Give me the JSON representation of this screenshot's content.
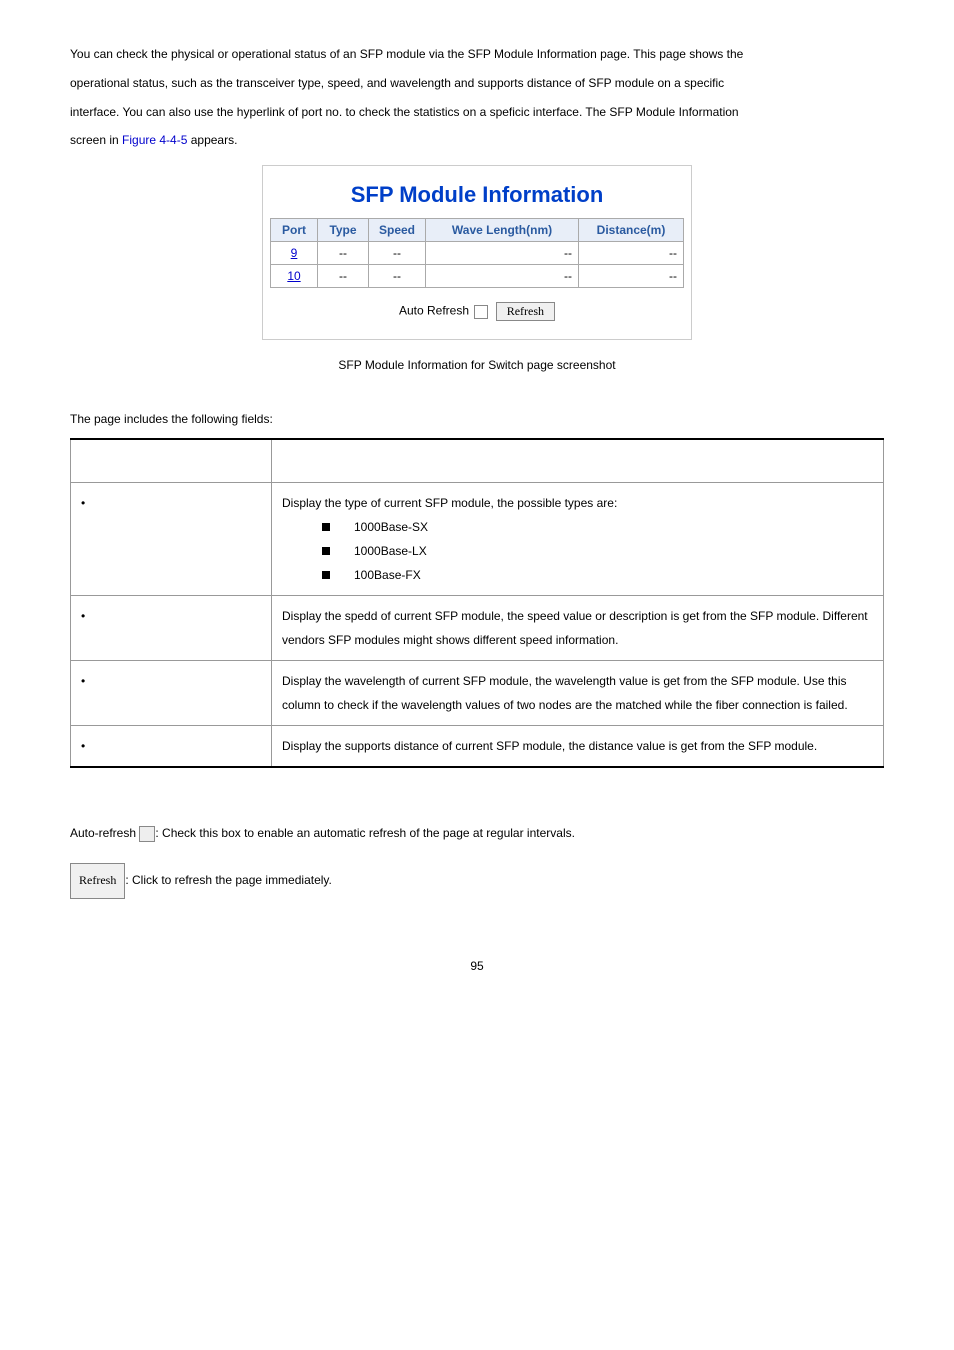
{
  "intro": {
    "line1": "You can check the physical or operational status of an SFP module via the SFP Module Information page. This page shows the",
    "line2": "operational status, such as the transceiver type, speed, and wavelength and supports distance of SFP module on a specific",
    "line3": "interface. You can also use the hyperlink of port no. to check the statistics on a speficic interface. The SFP Module Information",
    "line4a": "screen in ",
    "figref": "Figure 4-4-5",
    "line4b": " appears."
  },
  "panel": {
    "title": "SFP Module Information",
    "headers": [
      "Port",
      "Type",
      "Speed",
      "Wave Length(nm)",
      "Distance(m)"
    ],
    "rows": [
      {
        "port": "9",
        "type": "--",
        "speed": "--",
        "wave": "--",
        "dist": "--"
      },
      {
        "port": "10",
        "type": "--",
        "speed": "--",
        "wave": "--",
        "dist": "--"
      }
    ],
    "auto_refresh_label": "Auto Refresh",
    "refresh_label": "Refresh"
  },
  "caption": "SFP Module Information for Switch page screenshot",
  "fields_intro": "The page includes the following fields:",
  "fields": {
    "type": {
      "desc": "Display the type of current SFP module, the possible types are:",
      "items": [
        "1000Base-SX",
        "1000Base-LX",
        "100Base-FX"
      ]
    },
    "speed": {
      "desc": "Display the spedd of current SFP module, the speed value or description is get from the SFP module. Different vendors SFP modules might shows different speed information."
    },
    "wave": {
      "desc": "Display the wavelength of current SFP module, the wavelength value is get from the SFP module. Use this column to check if the wavelength values of two nodes are the matched while the fiber connection is failed."
    },
    "dist": {
      "desc": "Display the supports distance of current SFP module, the distance value is get from the SFP module."
    }
  },
  "footer": {
    "auto_refresh_prefix": "Auto-refresh ",
    "auto_refresh_text": ": Check this box to enable an automatic refresh of the page at regular intervals.",
    "refresh_label": "Refresh",
    "refresh_text": ": Click to refresh the page immediately."
  },
  "page_number": "95"
}
